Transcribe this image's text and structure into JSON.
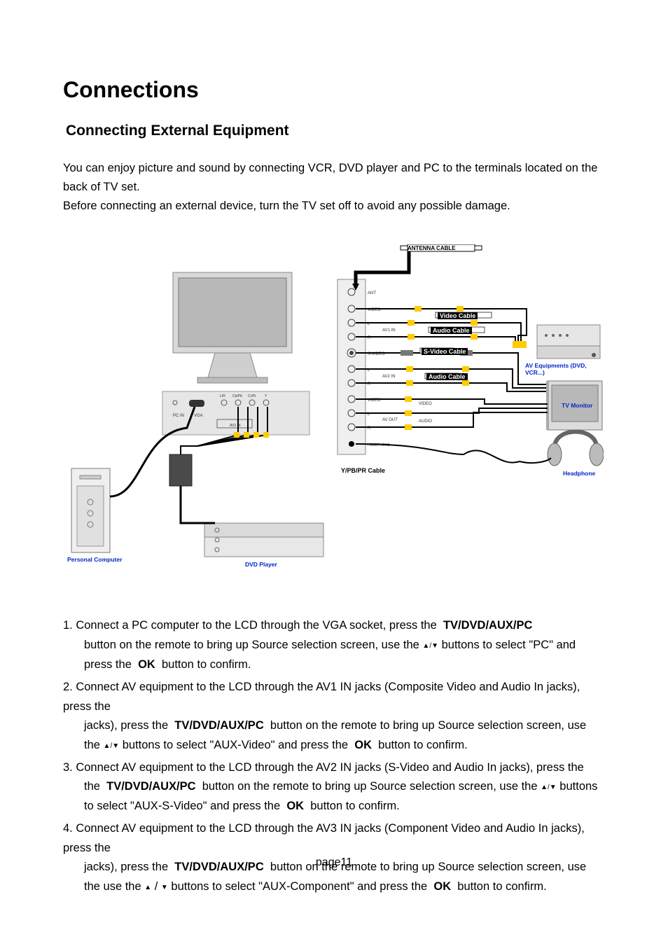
{
  "title": "Connections",
  "subtitle": "Connecting External Equipment",
  "intro_line1": "You can enjoy picture and sound by connecting VCR, DVD player and PC to the terminals located on the back of TV set.",
  "intro_line2": "Before connecting an external device, turn the TV set off to avoid any possible damage.",
  "diagram": {
    "antenna_cable": "ANTENNA CABLE",
    "video_cable": "Video Cable",
    "audio_cable": "Audio Cable",
    "svideo_cable": "S-Video Cable",
    "ypbpr_cable": "Y/PB/PR Cable",
    "av_equipments": "AV Equipments (DVD, VCR...)",
    "tv_monitor": "TV Monitor",
    "headphone": "Headphone",
    "dvd_player": "DVD Player",
    "personal_computer": "Personal Computer",
    "ports": {
      "ant": "ANT",
      "video": "VIDEO",
      "av1_in": "AV1 IN",
      "av2_in": "AV2 IN",
      "av3_in": "AV3 IN",
      "av_out": "AV OUT",
      "s_video": "S-VIDEO",
      "audio": "AUDIO",
      "l": "L",
      "r": "R",
      "headphone": "HEADPHONE",
      "pc_in": "PC IN",
      "vga": "VGA",
      "lr": "L/R",
      "cbpb": "Cb/Pb",
      "crpr": "Cr/Pr",
      "y": "Y"
    }
  },
  "steps": {
    "s1_a": "1. Connect a PC computer to the LCD through the VGA socket, press the ",
    "s1_b": "TV/DVD/AUX/PC",
    "s1_c": "button on the remote to bring up Source selection screen, use the",
    "s1_d": " buttons to select \"PC\" and press the ",
    "s1_e": "OK",
    "s1_f": " button to confirm.",
    "s2_a": "2. Connect AV equipment to the LCD through the AV1 IN jacks (Composite Video and Audio In jacks), press the ",
    "s2_b": "TV/DVD/AUX/PC",
    "s2_c": " button on the remote to bring up Source selection screen, use the ",
    "s2_d": " buttons to select \"AUX-Video\" and press the ",
    "s2_e": "OK",
    "s2_f": " button to confirm.",
    "s3_a": "3. Connect AV equipment to the LCD through the AV2 IN jacks (S-Video and Audio In jacks), press the ",
    "s3_b": "TV/DVD/AUX/PC",
    "s3_c": " button on the remote to bring up Source selection screen, use the ",
    "s3_d": " buttons to select \"AUX-S-Video\" and press the ",
    "s3_e": "OK",
    "s3_f": " button to confirm.",
    "s4_a": "4. Connect AV equipment to the LCD through the AV3 IN jacks (Component Video and Audio In jacks), press the ",
    "s4_b": "TV/DVD/AUX/PC",
    "s4_c": " button on the remote to bring up Source selection screen, use the ",
    "s4_d": " buttons to select \"AUX-Component\" and press the ",
    "s4_e": "OK",
    "s4_f": " button to confirm."
  },
  "footer": "page11",
  "glyphs": {
    "up": "▲",
    "down": "▼",
    "slash": " /"
  }
}
